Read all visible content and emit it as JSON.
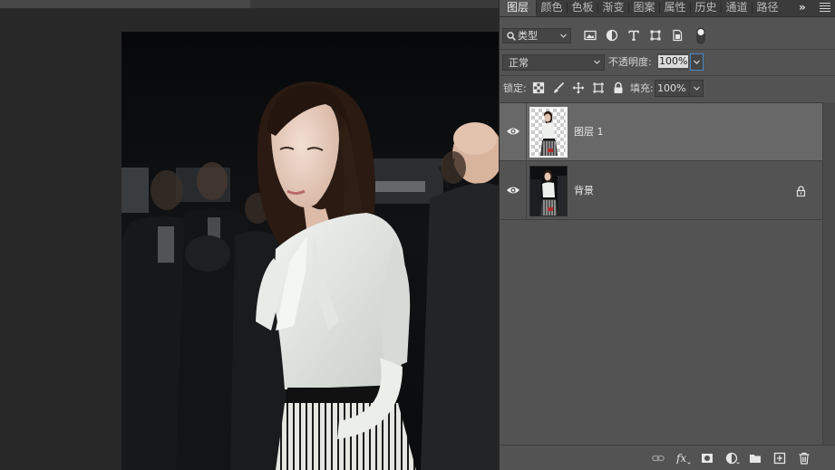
{
  "panel_tabs": [
    {
      "label": "图层",
      "active": true
    },
    {
      "label": "颜色",
      "active": false
    },
    {
      "label": "色板",
      "active": false
    },
    {
      "label": "渐变",
      "active": false
    },
    {
      "label": "图案",
      "active": false
    },
    {
      "label": "属性",
      "active": false
    },
    {
      "label": "历史",
      "active": false
    },
    {
      "label": "通道",
      "active": false
    },
    {
      "label": "路径",
      "active": false
    }
  ],
  "filter": {
    "kind_label": "类型",
    "icons": [
      "image-filter-icon",
      "adjustment-filter-icon",
      "type-filter-icon",
      "shape-filter-icon",
      "smart-object-filter-icon"
    ]
  },
  "blending": {
    "mode": "正常",
    "opacity_label": "不透明度:",
    "opacity": "100%"
  },
  "lock": {
    "label": "锁定:",
    "icons": [
      "lock-transparent-pixels-icon",
      "lock-image-pixels-icon",
      "lock-position-icon",
      "lock-artboard-icon",
      "lock-all-icon"
    ],
    "fill_label": "填充:",
    "fill": "100%"
  },
  "layers": [
    {
      "name": "图层 1",
      "visible": true,
      "selected": true,
      "locked": false
    },
    {
      "name": "背景",
      "visible": true,
      "selected": false,
      "locked": true
    }
  ],
  "bottom_icons": [
    "link-layers-icon",
    "fx-icon",
    "add-mask-icon",
    "new-adjustment-icon",
    "new-group-icon",
    "new-layer-icon",
    "delete-layer-icon"
  ],
  "colors": {
    "panel_bg": "#535353",
    "selected_row": "#686868",
    "focus_blue": "#4d86c8",
    "canvas_bg": "#282828"
  }
}
